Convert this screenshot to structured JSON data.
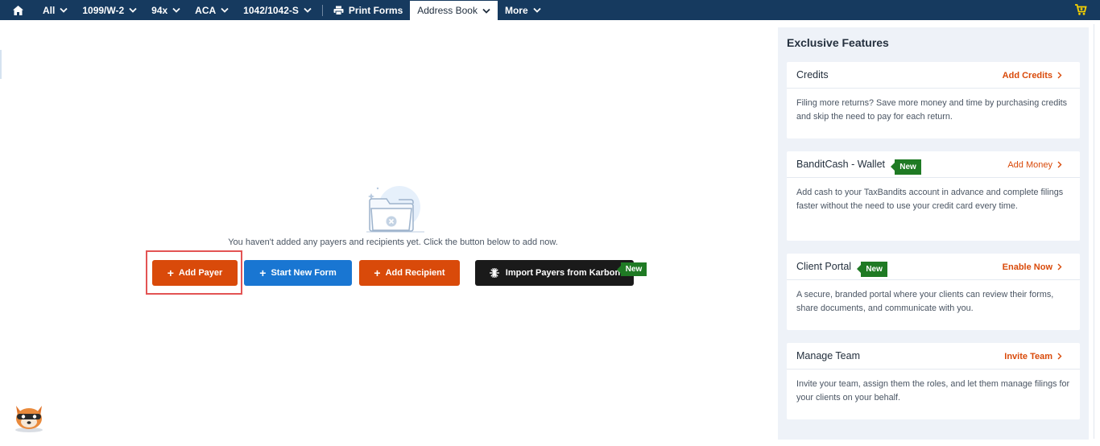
{
  "nav": {
    "items": [
      {
        "label": "All"
      },
      {
        "label": "1099/W-2"
      },
      {
        "label": "94x"
      },
      {
        "label": "ACA"
      },
      {
        "label": "1042/1042-S"
      }
    ],
    "print_forms": "Print Forms",
    "address_book": "Address Book",
    "more": "More"
  },
  "empty_state": {
    "message": "You haven't added any payers and recipients yet. Click the button below to add now."
  },
  "actions": {
    "add_payer": "Add Payer",
    "start_new_form": "Start New Form",
    "add_recipient": "Add Recipient",
    "import_karbon": "Import Payers from Karbon",
    "new_badge": "New"
  },
  "sidebar": {
    "title": "Exclusive Features",
    "cards": [
      {
        "title": "Credits",
        "action": "Add Credits",
        "body": "Filing more returns? Save more money and time by purchasing credits and skip the need to pay for each return."
      },
      {
        "title": "BanditCash - Wallet",
        "badge": "New",
        "action": "Add Money",
        "body": "Add cash to your TaxBandits account in advance and complete filings faster without the need to use your credit card every time."
      },
      {
        "title": "Client Portal",
        "badge": "New",
        "action": "Enable Now",
        "body": "A secure, branded portal where your clients can review their forms, share documents, and communicate with you."
      },
      {
        "title": "Manage Team",
        "action": "Invite Team",
        "body": "Invite your team, assign them the roles, and let them manage filings for your clients on your behalf."
      }
    ]
  },
  "colors": {
    "nav_bg": "#163a5f",
    "accent_orange": "#d94a0a",
    "primary_blue": "#1976d2",
    "badge_green": "#1f7a24",
    "cart_yellow": "#f5d000"
  }
}
